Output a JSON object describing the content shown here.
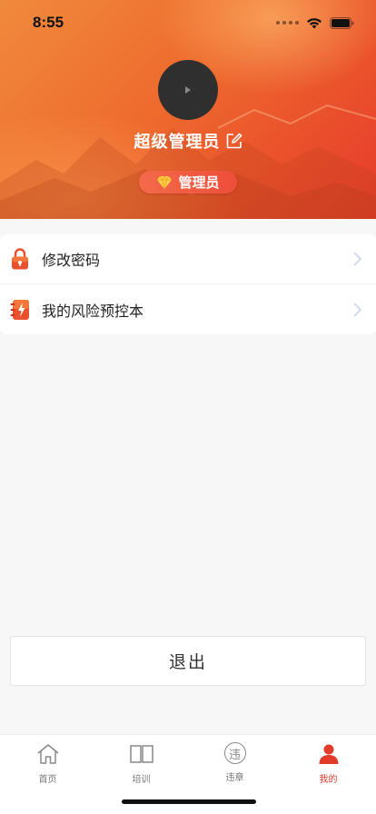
{
  "status_bar": {
    "time": "8:55"
  },
  "profile": {
    "username": "超级管理员",
    "role": "管理员",
    "avatar_icon": "play-icon",
    "edit_icon": "edit-icon"
  },
  "menu": {
    "items": [
      {
        "label": "修改密码",
        "icon": "lock-icon"
      },
      {
        "label": "我的风险预控本",
        "icon": "notebook-icon"
      }
    ]
  },
  "logout": {
    "label": "退出"
  },
  "tabbar": {
    "tabs": [
      {
        "label": "首页",
        "icon": "home-icon"
      },
      {
        "label": "培训",
        "icon": "book-icon"
      },
      {
        "label": "违章",
        "icon": "violation-icon",
        "icon_text": "违"
      },
      {
        "label": "我的",
        "icon": "user-icon"
      }
    ],
    "active_index": 3
  },
  "colors": {
    "accent": "#e23b2a",
    "header_start": "#f08a3c",
    "header_end": "#e63a2a"
  }
}
